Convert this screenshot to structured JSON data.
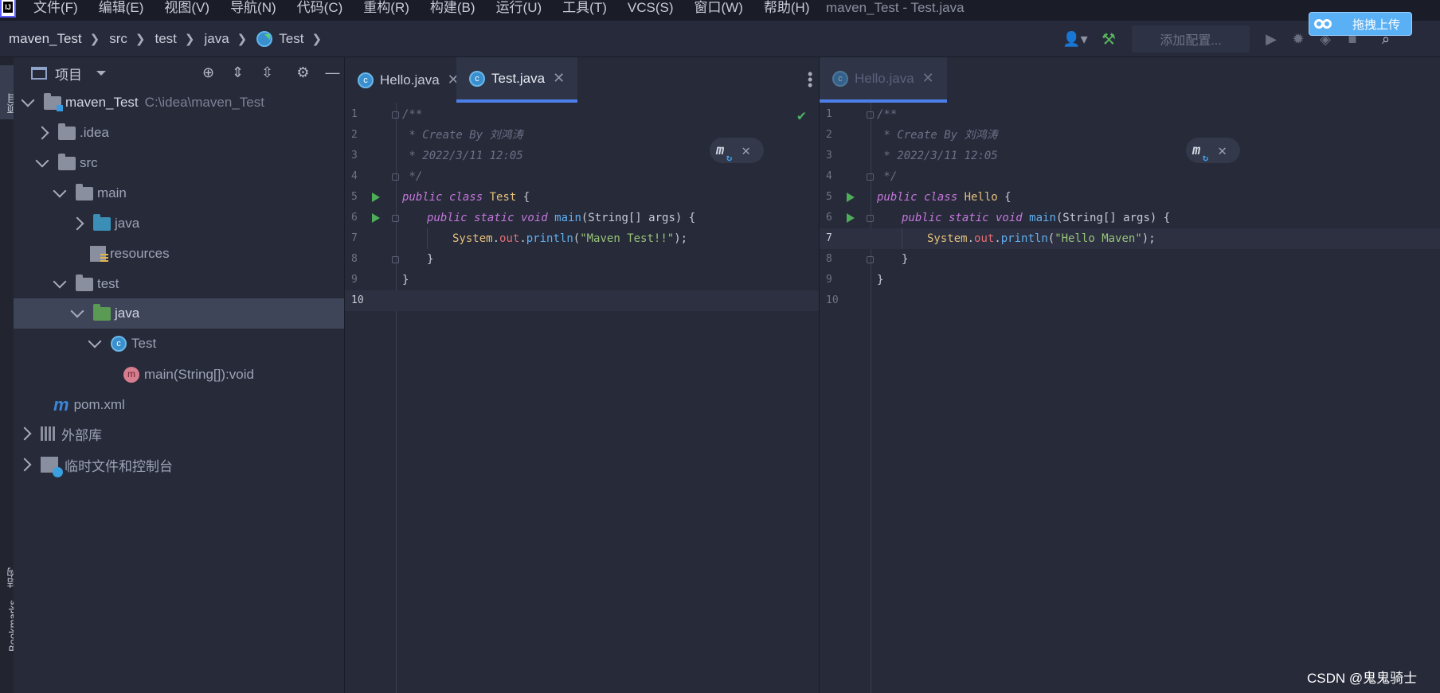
{
  "app": {
    "logo_text": "IJ",
    "window_title": "maven_Test - Test.java"
  },
  "menu": {
    "items": [
      "文件(F)",
      "编辑(E)",
      "视图(V)",
      "导航(N)",
      "代码(C)",
      "重构(R)",
      "构建(B)",
      "运行(U)",
      "工具(T)",
      "VCS(S)",
      "窗口(W)",
      "帮助(H)"
    ]
  },
  "upload": {
    "label": "拖拽上传",
    "color": "#5ab0f5"
  },
  "breadcrumb": {
    "items": [
      "maven_Test",
      "src",
      "test",
      "java",
      "Test"
    ]
  },
  "toolbar": {
    "run_config_placeholder": "添加配置..."
  },
  "left_strip": {
    "project_tab": "项目",
    "structure_tab": "结构",
    "bookmarks_tab": "Bookmarks"
  },
  "project": {
    "header_title": "项目",
    "tree": [
      {
        "label": "maven_Test",
        "path": "C:\\idea\\maven_Test"
      },
      {
        "label": ".idea"
      },
      {
        "label": "src"
      },
      {
        "label": "main"
      },
      {
        "label": "java"
      },
      {
        "label": "resources"
      },
      {
        "label": "test"
      },
      {
        "label": "java"
      },
      {
        "label": "Test"
      },
      {
        "label": "main(String[]):void"
      },
      {
        "label": "pom.xml"
      },
      {
        "label": "外部库"
      },
      {
        "label": "临时文件和控制台"
      }
    ]
  },
  "editor_left": {
    "tabs": [
      "Hello.java",
      "Test.java"
    ],
    "active_tab": "Test.java",
    "lines": [
      {
        "n": "1",
        "text": "/**"
      },
      {
        "n": "2",
        "text": " * Create By 刘鸿涛"
      },
      {
        "n": "3",
        "text": " * 2022/3/11 12:05"
      },
      {
        "n": "4",
        "text": " */"
      },
      {
        "n": "5",
        "kw": "public class ",
        "cls": "Test",
        "rest": " {"
      },
      {
        "n": "6",
        "kw": "public static void ",
        "fn": "main",
        "rest": "(String[] args) {"
      },
      {
        "n": "7",
        "obj": "System",
        "dot1": ".",
        "field": "out",
        "dot2": ".",
        "method": "println",
        "open": "(",
        "str": "\"Maven Test!!\"",
        "close": ");"
      },
      {
        "n": "8",
        "text": "}"
      },
      {
        "n": "9",
        "text": "}"
      },
      {
        "n": "10",
        "text": ""
      }
    ]
  },
  "editor_right": {
    "tabs": [
      "Hello.java"
    ],
    "lines": [
      {
        "n": "1",
        "text": "/**"
      },
      {
        "n": "2",
        "text": " * Create By 刘鸿涛"
      },
      {
        "n": "3",
        "text": " * 2022/3/11 12:05"
      },
      {
        "n": "4",
        "text": " */"
      },
      {
        "n": "5",
        "kw": "public class ",
        "cls": "Hello",
        "rest": " {"
      },
      {
        "n": "6",
        "kw": "public static void ",
        "fn": "main",
        "rest": "(String[] args) {"
      },
      {
        "n": "7",
        "obj": "System",
        "dot1": ".",
        "field": "out",
        "dot2": ".",
        "method": "println",
        "open": "(",
        "str": "\"Hello Maven\"",
        "close": ");"
      },
      {
        "n": "8",
        "text": "}"
      },
      {
        "n": "9",
        "text": "}"
      },
      {
        "n": "10",
        "text": ""
      }
    ]
  },
  "watermark": "CSDN @鬼鬼骑士",
  "colors": {
    "accent": "#4c80e8",
    "run_green": "#4dae58",
    "background": "#262a39"
  }
}
